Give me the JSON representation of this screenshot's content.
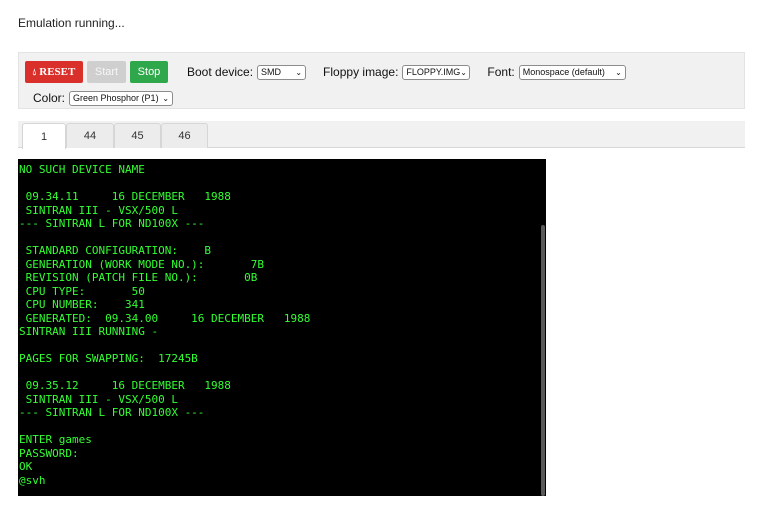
{
  "status_text": "Emulation running...",
  "controls": {
    "reset_label": "RESET",
    "reset_icon": "drop-icon",
    "start_label": "Start",
    "stop_label": "Stop",
    "boot_device_label": "Boot device:",
    "boot_device_value": "SMD",
    "floppy_label": "Floppy image:",
    "floppy_value": "FLOPPY.IMG",
    "font_label": "Font:",
    "font_value": "Monospace (default)",
    "color_label": "Color:",
    "color_value": "Green Phosphor (P1)"
  },
  "tabs": [
    {
      "label": "1",
      "active": true
    },
    {
      "label": "44",
      "active": false
    },
    {
      "label": "45",
      "active": false
    },
    {
      "label": "46",
      "active": false
    }
  ],
  "terminal": {
    "text_color": "#33ff33",
    "background": "#000000",
    "lines": [
      "NO SUCH DEVICE NAME",
      "",
      " 09.34.11     16 DECEMBER   1988",
      " SINTRAN III - VSX/500 L",
      "--- SINTRAN L FOR ND100X ---",
      "",
      " STANDARD CONFIGURATION:    B",
      " GENERATION (WORK MODE NO.):       7B",
      " REVISION (PATCH FILE NO.):       0B",
      " CPU TYPE:       50",
      " CPU NUMBER:    341",
      " GENERATED:  09.34.00     16 DECEMBER   1988",
      "SINTRAN III RUNNING -",
      "",
      "PAGES FOR SWAPPING:  17245B",
      "",
      " 09.35.12     16 DECEMBER   1988",
      " SINTRAN III - VSX/500 L",
      "--- SINTRAN L FOR ND100X ---",
      "",
      "ENTER games",
      "PASSWORD:",
      "OK",
      "@svh"
    ]
  }
}
